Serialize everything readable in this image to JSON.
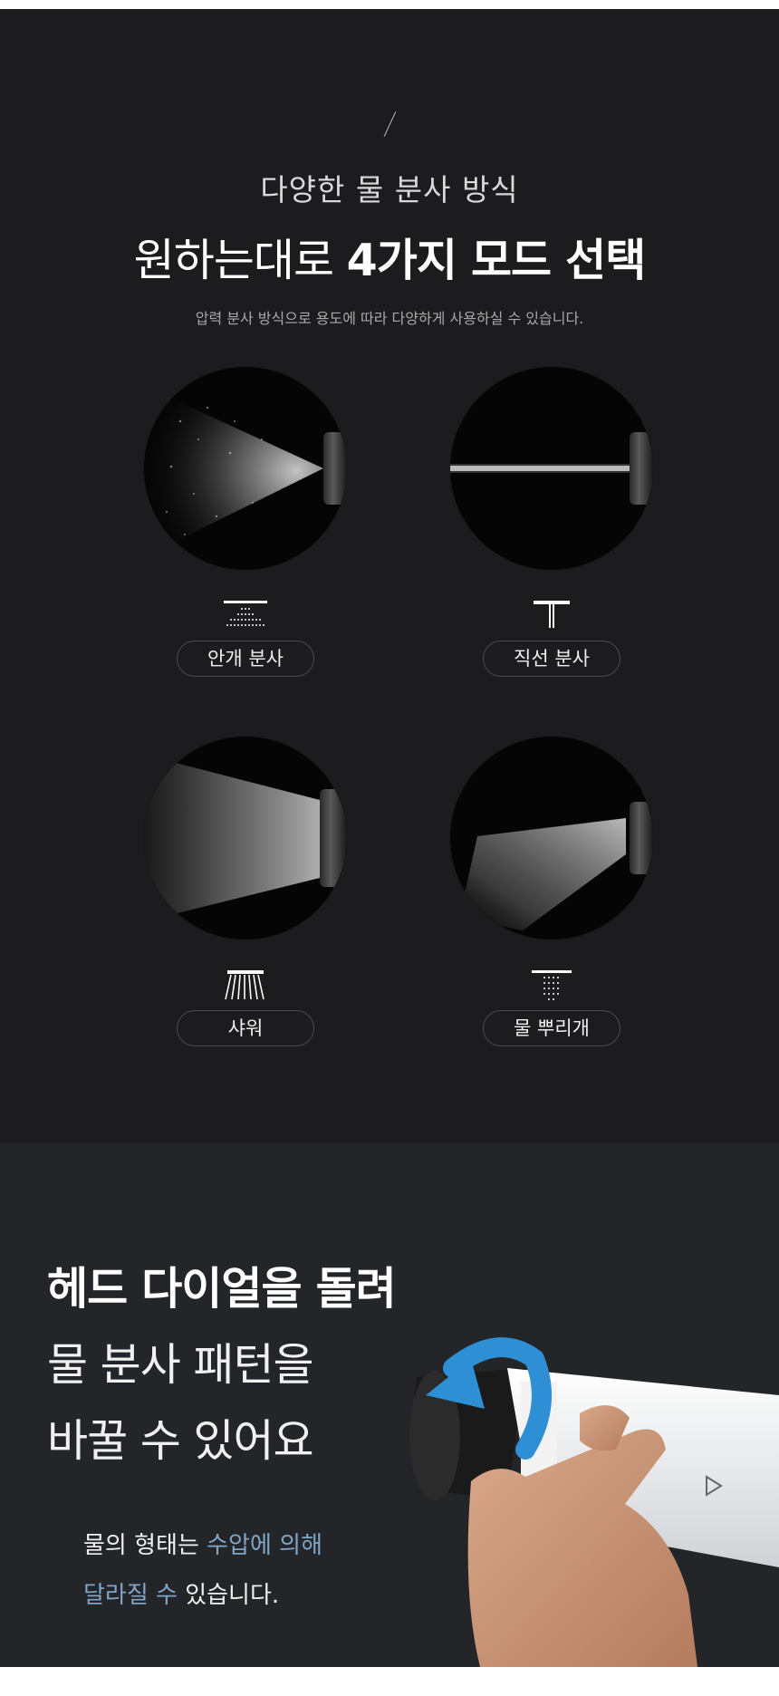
{
  "intro": {
    "subtitle": "다양한 물 분사 방식",
    "title_normal": "원하는대로",
    "title_bold": "4가지 모드 선택",
    "description": "압력 분사 방식으로 용도에 따라 다양하게 사용하실 수 있습니다."
  },
  "modes": [
    {
      "label": "안개 분사",
      "icon": "mist-icon"
    },
    {
      "label": "직선 분사",
      "icon": "jet-icon"
    },
    {
      "label": "샤워",
      "icon": "shower-icon"
    },
    {
      "label": "물 뿌리개",
      "icon": "sprinkler-icon"
    }
  ],
  "dial": {
    "heading_bold": "헤드 다이얼을 돌려",
    "heading_line2": "물 분사 패턴을",
    "heading_line3": "바꿀 수 있어요",
    "note_line1_plain": "물의 형태는 ",
    "note_line1_highlight": "수압에 의해",
    "note_line2_highlight": "달라질 수",
    "note_line2_plain": " 있습니다."
  },
  "colors": {
    "background_top": "#1c1c1e",
    "background_bottom": "#242528",
    "highlight": "#7fa5c8",
    "rotate_arrow": "#2e8fd4"
  }
}
